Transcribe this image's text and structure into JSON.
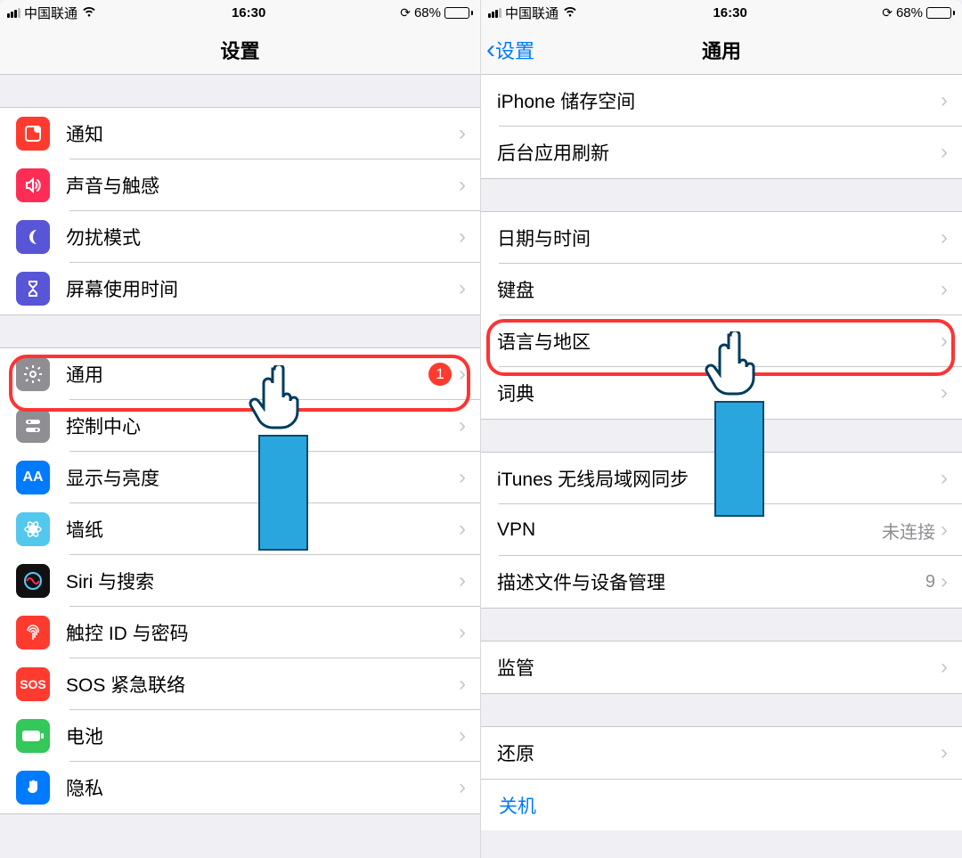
{
  "status": {
    "carrier": "中国联通",
    "time": "16:30",
    "battery_pct": "68%"
  },
  "left": {
    "title": "设置",
    "group1": [
      {
        "label": "通知"
      },
      {
        "label": "声音与触感"
      },
      {
        "label": "勿扰模式"
      },
      {
        "label": "屏幕使用时间"
      }
    ],
    "group2": [
      {
        "label": "通用",
        "badge": "1"
      },
      {
        "label": "控制中心"
      },
      {
        "label": "显示与亮度"
      },
      {
        "label": "墙纸"
      },
      {
        "label": "Siri 与搜索"
      },
      {
        "label": "触控 ID 与密码"
      },
      {
        "label": "SOS 紧急联络"
      },
      {
        "label": "电池"
      },
      {
        "label": "隐私"
      }
    ]
  },
  "right": {
    "back": "设置",
    "title": "通用",
    "group1": [
      {
        "label": "iPhone 储存空间"
      },
      {
        "label": "后台应用刷新"
      }
    ],
    "group2": [
      {
        "label": "日期与时间"
      },
      {
        "label": "键盘"
      },
      {
        "label": "语言与地区"
      },
      {
        "label": "词典"
      }
    ],
    "group3": [
      {
        "label": "iTunes 无线局域网同步"
      },
      {
        "label": "VPN",
        "detail": "未连接"
      },
      {
        "label": "描述文件与设备管理",
        "detail": "9"
      }
    ],
    "group4": [
      {
        "label": "监管"
      }
    ],
    "group5": [
      {
        "label": "还原"
      }
    ],
    "shutdown": "关机"
  }
}
